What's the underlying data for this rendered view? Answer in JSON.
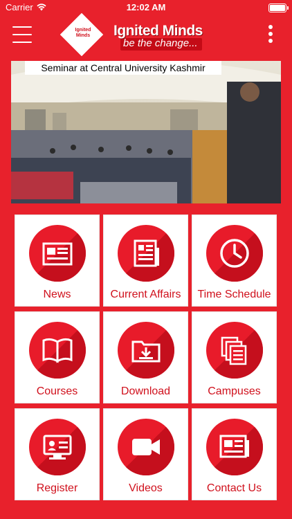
{
  "status_bar": {
    "carrier": "Carrier",
    "time": "12:02 AM"
  },
  "app": {
    "logo_mark": "Ignited Minds",
    "title": "Ignited Minds",
    "tagline": "be the change..."
  },
  "hero": {
    "caption": "Seminar at Central University Kashmir"
  },
  "tiles": [
    {
      "label": "News",
      "icon": "newspaper-icon"
    },
    {
      "label": "Current Affairs",
      "icon": "document-list-icon"
    },
    {
      "label": "Time Schedule",
      "icon": "clock-icon"
    },
    {
      "label": "Courses",
      "icon": "open-book-icon"
    },
    {
      "label": "Download",
      "icon": "download-folder-icon"
    },
    {
      "label": "Campuses",
      "icon": "documents-stack-icon"
    },
    {
      "label": "Register",
      "icon": "id-card-monitor-icon"
    },
    {
      "label": "Videos",
      "icon": "video-camera-icon"
    },
    {
      "label": "Contact Us",
      "icon": "contact-card-icon"
    }
  ],
  "colors": {
    "primary": "#e8212c",
    "tile_bg": "#ffffff",
    "label": "#d0101c"
  }
}
